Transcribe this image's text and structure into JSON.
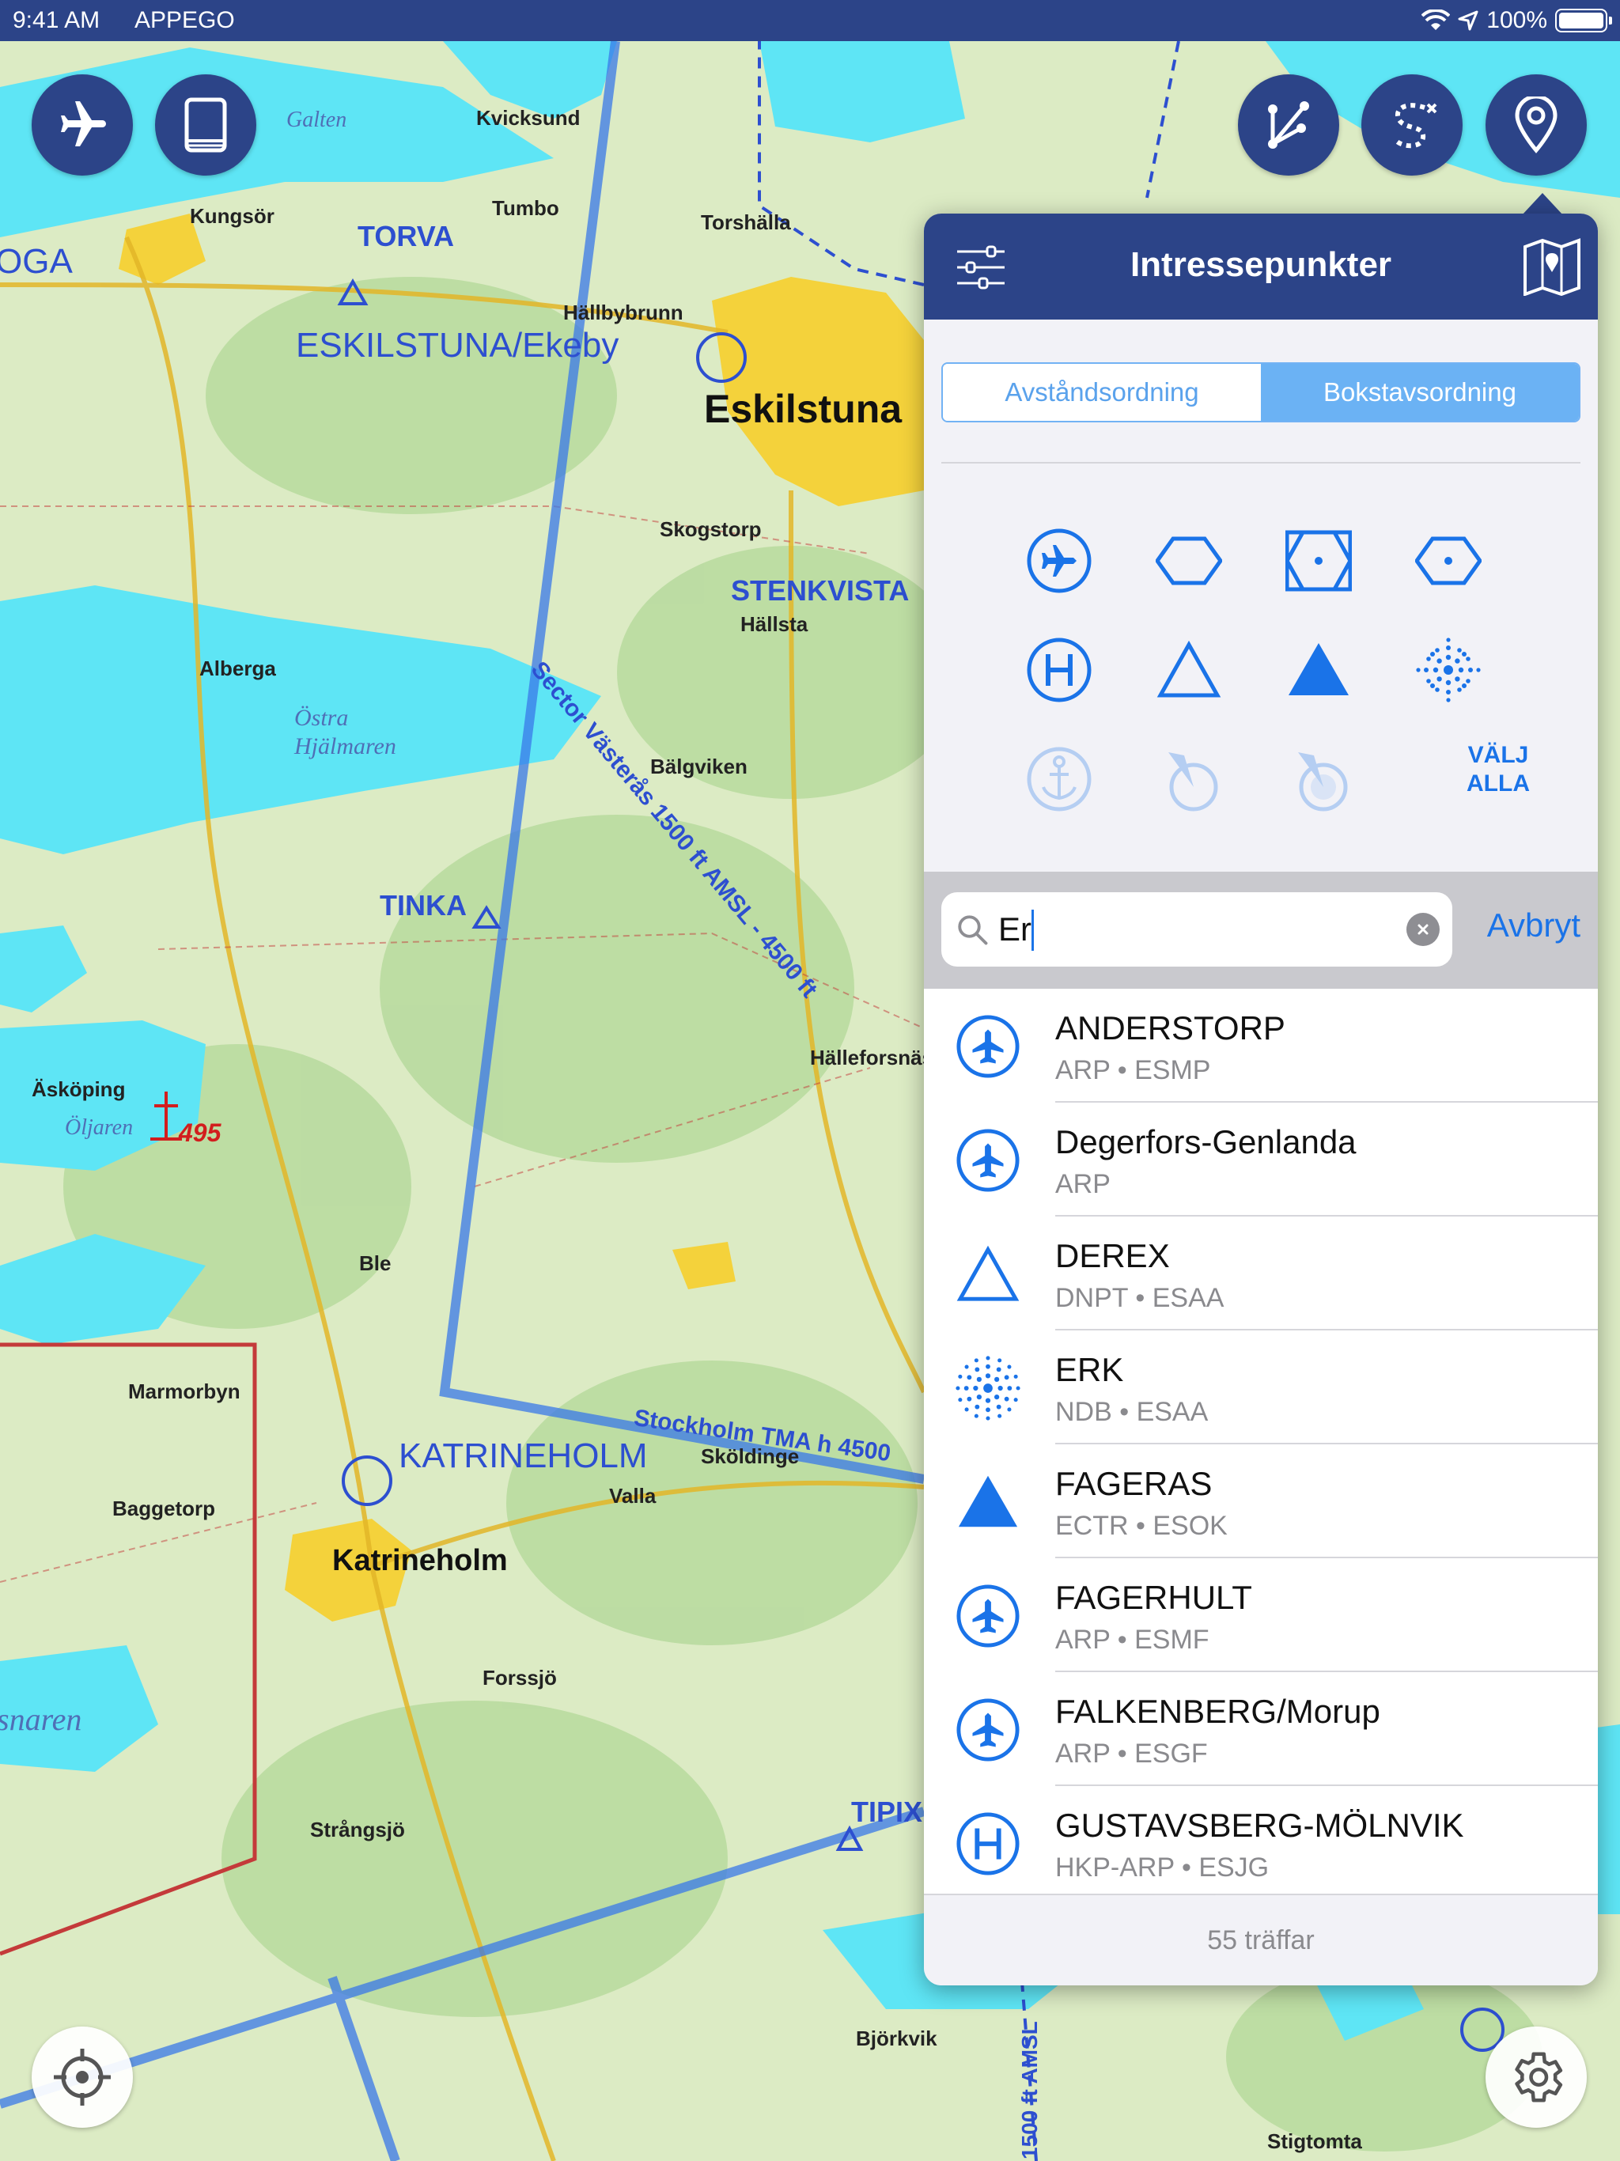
{
  "status_bar": {
    "time": "9:41 AM",
    "carrier": "APPEGO",
    "battery": "100%"
  },
  "toolbar": {
    "aircraft_icon": "airplane-icon",
    "book_icon": "book-icon",
    "route_icon": "route-icon",
    "trace_icon": "trace-path-icon",
    "poi_icon": "location-pin-icon",
    "locate_icon": "crosshair-icon",
    "settings_icon": "gear-icon"
  },
  "map": {
    "labels": {
      "galten": "Galten",
      "kvicksund": "Kvicksund",
      "kungsor": "Kungsör",
      "torva": "TORVA",
      "tumbo": "Tumbo",
      "torshalla": "Torshälla",
      "hallbybrunn": "Hällbybrunn",
      "oga": "OGA",
      "eskilstuna_ekeby": "ESKILSTUNA/Ekeby",
      "eskilstuna": "Eskilstuna",
      "skogstorp": "Skogstorp",
      "stenkvista": "STENKVISTA",
      "hallsta": "Hällsta",
      "alberga": "Alberga",
      "ostra_hjalmaren": "Östra Hjälmaren",
      "balgviken": "Bälgviken",
      "sector": "Sector Västerås 1500 ft AMSL - 4500 ft",
      "tinka": "TINKA",
      "hälleforsnäs": "Hälleforsnäs",
      "askoping": "Äsköping",
      "oljaren": "Öljaren",
      "obstacle": "495",
      "ble": "Ble",
      "marmorbyn": "Marmorbyn",
      "katrineholm_arp": "KATRINEHOLM",
      "stockholm_tma": "Stockholm TMA h 4500",
      "skoldinge": "Sköldinge",
      "valla": "Valla",
      "baggetorp": "Baggetorp",
      "katrineholm": "Katrineholm",
      "forssjo": "Forssjö",
      "snaren": "snaren",
      "strangsjo": "Strångsjö",
      "tipix": "TIPIX",
      "bjorkvik": "Björkvik",
      "stigtomta": "Stigtomta",
      "amsl_vertical": "1500 ft AMSL"
    }
  },
  "panel": {
    "title": "Intressepunkter",
    "filter_icon": "sliders-icon",
    "map_book_icon": "map-book-icon",
    "tabs": [
      {
        "label": "Avståndsordning",
        "active": false
      },
      {
        "label": "Bokstavsordning",
        "active": true
      }
    ],
    "types": [
      {
        "name": "airport-icon",
        "enabled": true
      },
      {
        "name": "hexagon-icon",
        "enabled": true
      },
      {
        "name": "vor-dme-icon",
        "enabled": true
      },
      {
        "name": "vor-icon",
        "enabled": true
      },
      {
        "name": "heliport-icon",
        "enabled": true
      },
      {
        "name": "waypoint-triangle-icon",
        "enabled": true
      },
      {
        "name": "reporting-point-icon",
        "enabled": true
      },
      {
        "name": "ndb-icon",
        "enabled": true
      },
      {
        "name": "seaplane-anchor-icon",
        "enabled": false
      },
      {
        "name": "windsock-icon",
        "enabled": false
      },
      {
        "name": "windsock-alt-icon",
        "enabled": false
      }
    ],
    "select_all_line1": "VÄLJ",
    "select_all_line2": "ALLA",
    "search": {
      "value": "Er",
      "placeholder": "",
      "cancel": "Avbryt"
    },
    "results": [
      {
        "name": "ANDERSTORP",
        "sub": "ARP • ESMP",
        "icon": "airport-icon"
      },
      {
        "name": "Degerfors-Genlanda",
        "sub": "ARP",
        "icon": "airport-icon"
      },
      {
        "name": "DEREX",
        "sub": "DNPT • ESAA",
        "icon": "waypoint-triangle-icon"
      },
      {
        "name": "ERK",
        "sub": "NDB • ESAA",
        "icon": "ndb-icon"
      },
      {
        "name": "FAGERAS",
        "sub": "ECTR • ESOK",
        "icon": "reporting-point-icon"
      },
      {
        "name": "FAGERHULT",
        "sub": "ARP • ESMF",
        "icon": "airport-icon"
      },
      {
        "name": "FALKENBERG/Morup",
        "sub": "ARP • ESGF",
        "icon": "airport-icon"
      },
      {
        "name": "GUSTAVSBERG-MÖLNVIK",
        "sub": "HKP-ARP • ESJG",
        "icon": "heliport-icon"
      }
    ],
    "result_count": "55 träffar"
  },
  "colors": {
    "nav_blue": "#2c4488",
    "accent": "#1a73e8",
    "segment_active": "#6bb2f4",
    "water": "#5ee5f5",
    "land": "#dcebc4"
  }
}
